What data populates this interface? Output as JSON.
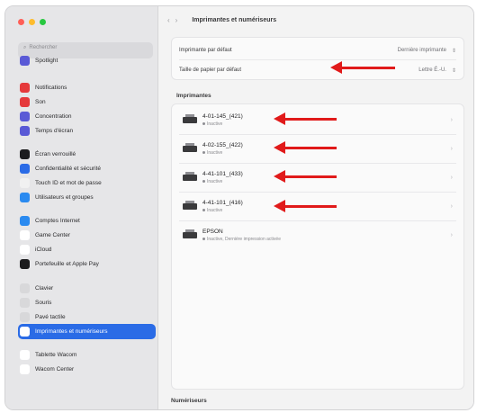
{
  "window": {
    "traffic_colors": [
      "#ff5f57",
      "#febc2e",
      "#28c840"
    ]
  },
  "sidebar": {
    "search_placeholder": "Rechercher",
    "items": [
      {
        "label": "Spotlight",
        "color": "#5a5ad6",
        "icon": "spotlight-icon",
        "selected": false
      },
      {
        "label": "Notifications",
        "color": "#e5393b",
        "icon": "bell-icon",
        "selected": false
      },
      {
        "label": "Son",
        "color": "#e5393b",
        "icon": "speaker-icon",
        "selected": false
      },
      {
        "label": "Concentration",
        "color": "#5a5ad6",
        "icon": "moon-icon",
        "selected": false
      },
      {
        "label": "Temps d'écran",
        "color": "#5a5ad6",
        "icon": "hourglass-icon",
        "selected": false
      },
      {
        "label": "Écran verrouillé",
        "color": "#1c1c1e",
        "icon": "lock-icon",
        "selected": false
      },
      {
        "label": "Confidentialité et sécurité",
        "color": "#2a6be6",
        "icon": "hand-icon",
        "selected": false
      },
      {
        "label": "Touch ID et mot de passe",
        "color": "#f1f1f1",
        "icon": "fingerprint-icon",
        "selected": false
      },
      {
        "label": "Utilisateurs et groupes",
        "color": "#2a8af0",
        "icon": "users-icon",
        "selected": false
      },
      {
        "label": "Comptes Internet",
        "color": "#2a8af0",
        "icon": "at-icon",
        "selected": false
      },
      {
        "label": "Game Center",
        "color": "#ffffff",
        "icon": "gamecenter-icon",
        "selected": false
      },
      {
        "label": "iCloud",
        "color": "#ffffff",
        "icon": "cloud-icon",
        "selected": false
      },
      {
        "label": "Portefeuille et Apple Pay",
        "color": "#1c1c1e",
        "icon": "wallet-icon",
        "selected": false
      },
      {
        "label": "Clavier",
        "color": "#d8d8da",
        "icon": "keyboard-icon",
        "selected": false
      },
      {
        "label": "Souris",
        "color": "#d8d8da",
        "icon": "mouse-icon",
        "selected": false
      },
      {
        "label": "Pavé tactile",
        "color": "#d8d8da",
        "icon": "trackpad-icon",
        "selected": false
      },
      {
        "label": "Imprimantes et numériseurs",
        "color": "#ffffff",
        "icon": "printer-icon",
        "selected": true
      },
      {
        "label": "Tablette Wacom",
        "color": "#ffffff",
        "icon": "wacom-tablet-icon",
        "selected": false
      },
      {
        "label": "Wacom Center",
        "color": "#ffffff",
        "icon": "wacom-center-icon",
        "selected": false
      }
    ]
  },
  "toolbar": {
    "back_glyph": "‹",
    "forward_glyph": "›",
    "title": "Imprimantes et numériseurs"
  },
  "settings": {
    "default_printer_label": "Imprimante par défaut",
    "default_printer_value": "Dernière imprimante",
    "paper_size_label": "Taille de papier par défaut",
    "paper_size_value": "Lettre É.-U.",
    "stepper_glyph": "⇕"
  },
  "printers_section_label": "Imprimantes",
  "printers": [
    {
      "name": "4-01-145_(421)",
      "status": "Inactive"
    },
    {
      "name": "4-02-155_(422)",
      "status": "Inactive"
    },
    {
      "name": "4-41-101_(433)",
      "status": "Inactive"
    },
    {
      "name": "4-41-101_(416)",
      "status": "Inactive"
    },
    {
      "name": "EPSON",
      "status": "Inactive, Dernière impression activée"
    }
  ],
  "scanners_section_label": "Numériseurs",
  "accent_color": "#2a6be6",
  "arrow_color": "#e11a1a"
}
